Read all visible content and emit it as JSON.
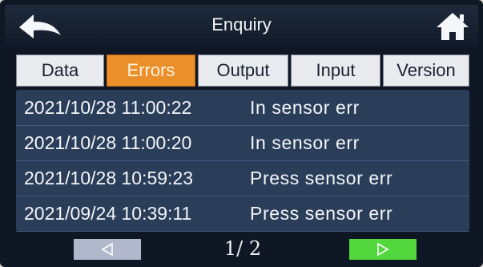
{
  "header": {
    "title": "Enquiry",
    "back_icon": "back-arrow-icon",
    "home_icon": "home-icon"
  },
  "tabs": [
    {
      "label": "Data",
      "active": false
    },
    {
      "label": "Errors",
      "active": true
    },
    {
      "label": "Output",
      "active": false
    },
    {
      "label": "Input",
      "active": false
    },
    {
      "label": "Version",
      "active": false
    }
  ],
  "errors": [
    {
      "timestamp": "2021/10/28 11:00:22",
      "message": "In sensor err"
    },
    {
      "timestamp": "2021/10/28 11:00:20",
      "message": "In sensor err"
    },
    {
      "timestamp": "2021/10/28 10:59:23",
      "message": "Press sensor err"
    },
    {
      "timestamp": "2021/09/24 10:39:11",
      "message": "Press sensor err"
    }
  ],
  "pagination": {
    "text": "1/ 2",
    "prev_icon": "triangle-left-icon",
    "next_icon": "triangle-right-icon"
  },
  "colors": {
    "active_tab": "#eb8f2a",
    "list_background": "#2a3d59",
    "next_button": "#52d83d",
    "prev_button": "#b2b8cc"
  }
}
